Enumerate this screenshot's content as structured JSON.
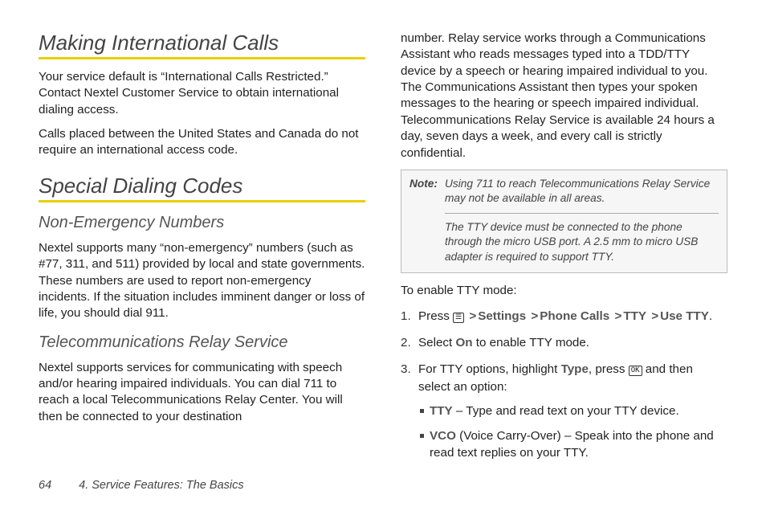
{
  "left": {
    "h1_intl": "Making International Calls",
    "p_intl_1": "Your service default is “International Calls Restricted.” Contact Nextel Customer Service to obtain international dialing access.",
    "p_intl_2": "Calls placed between the United States and Canada do not require an international access code.",
    "h1_special": "Special Dialing Codes",
    "h2_nonemerg": "Non-Emergency Numbers",
    "p_nonemerg": "Nextel supports many “non-emergency” numbers (such as #77, 311, and 511) provided by local and state governments. These numbers are used to report non-emergency incidents. If the situation includes imminent danger or loss of life, you should dial 911.",
    "h2_relay": "Telecommunications Relay Service",
    "p_relay": "Nextel supports services for communicating with speech and/or hearing impaired individuals. You can dial 711 to reach a local Telecommunications Relay Center. You will then be connected to your destination"
  },
  "right": {
    "p_relay_cont": "number. Relay service works through a Communications Assistant who reads messages typed into a TDD/TTY device by a speech or hearing impaired individual to you. The Communications Assistant then types your spoken messages to the hearing or speech impaired individual. Telecommunications Relay Service is available 24 hours a day, seven days a week, and every call is strictly confidential.",
    "note_label": "Note:",
    "note_1": "Using 711 to reach Telecommunications Relay Service may not be available in all areas.",
    "note_2": "The TTY device must be connected to the phone through the micro USB port. A 2.5 mm to micro USB adapter is required to support TTY.",
    "lead": "To enable TTY mode:",
    "step1_pre": "Press ",
    "step1_menuicon": "☰",
    "nav": {
      "settings": "Settings",
      "phonecalls": "Phone Calls",
      "tty": "TTY",
      "usetty": "Use TTY"
    },
    "step2_a": "Select ",
    "step2_on": "On",
    "step2_b": " to enable TTY mode.",
    "step3_a": "For TTY options, highlight ",
    "step3_type": "Type",
    "step3_b": ", press ",
    "step3_okicon": "OK",
    "step3_c": " and then select an option:",
    "opt1_b": "TTY",
    "opt1_t": " – Type and read text on your TTY device.",
    "opt2_b": "VCO",
    "opt2_t": " (Voice Carry-Over) – Speak into the phone and read text replies on your TTY."
  },
  "footer": {
    "page": "64",
    "section": "4. Service Features: The Basics"
  },
  "chev": ">"
}
